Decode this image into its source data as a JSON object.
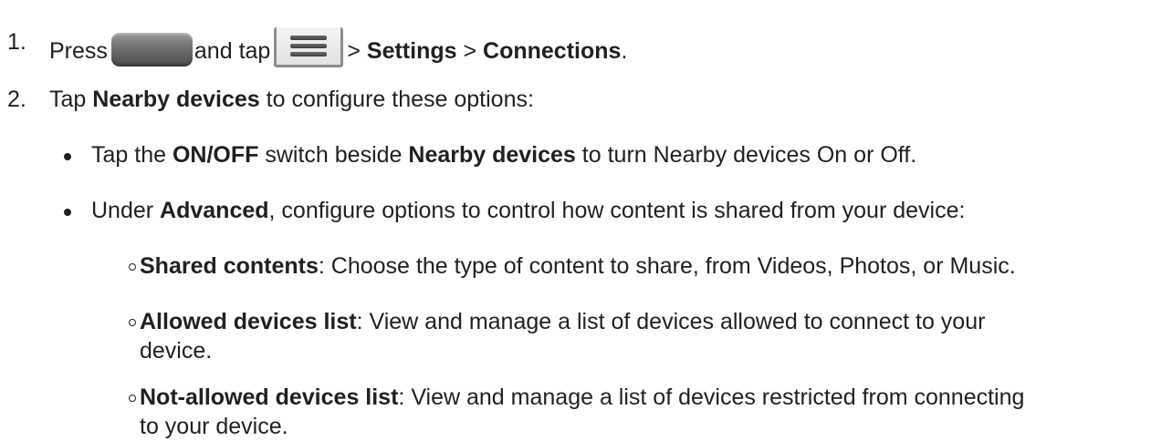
{
  "step1": {
    "number": "1.",
    "press": "Press",
    "and_tap": "and tap",
    "sep1": ">",
    "settings": "Settings",
    "sep2": ">",
    "connections": "Connections",
    "end": "."
  },
  "step2": {
    "number": "2.",
    "tap": "Tap",
    "nearby_devices": "Nearby devices",
    "rest": "to configure these options:"
  },
  "bullet1": {
    "tap_the": "Tap the",
    "onoff": "ON/OFF",
    "switch_beside": "switch beside",
    "nearby_devices": "Nearby devices",
    "rest": "to turn Nearby devices On or Off."
  },
  "bullet2": {
    "under": "Under",
    "advanced": "Advanced",
    "rest": ", configure options to control how content is shared from your device:"
  },
  "sub1": {
    "title": "Shared contents",
    "rest": ": Choose the type of content to share, from Videos, Photos, or Music."
  },
  "sub2": {
    "title": "Allowed devices list",
    "rest_line1": ": View and manage a list of devices allowed to connect to your",
    "rest_line2": "device."
  },
  "sub3": {
    "title": "Not-allowed devices list",
    "rest_line1": ": View and manage a list of devices restricted from connecting",
    "rest_line2": "to your device."
  },
  "icons": {
    "home_key": "home-key-icon",
    "menu_key": "menu-key-icon"
  }
}
